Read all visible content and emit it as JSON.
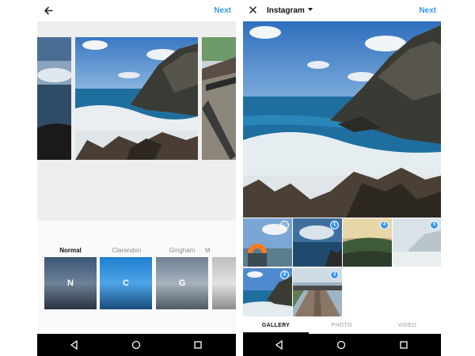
{
  "left_screen": {
    "next_label": "Next",
    "filters": [
      {
        "name": "Normal",
        "letter": "N",
        "selected": true
      },
      {
        "name": "Clarendon",
        "letter": "C",
        "selected": false
      },
      {
        "name": "Gingham",
        "letter": "G",
        "selected": false
      },
      {
        "name": "M",
        "letter": "",
        "selected": false
      }
    ]
  },
  "right_screen": {
    "title": "Instagram",
    "next_label": "Next",
    "gallery": [
      {
        "badge": "",
        "selected": false
      },
      {
        "badge": "1",
        "selected": true
      },
      {
        "badge": "4",
        "selected": true
      },
      {
        "badge": "5",
        "selected": true
      },
      {
        "badge": "2",
        "selected": true
      },
      {
        "badge": "3",
        "selected": true
      }
    ],
    "tabs": [
      "GALLERY",
      "PHOTO",
      "VIDEO"
    ],
    "active_tab": "GALLERY"
  },
  "icons": {
    "back": "arrow-left-icon",
    "close": "close-icon",
    "dropdown": "caret-down-icon",
    "nav_back": "triangle-back-icon",
    "nav_home": "circle-home-icon",
    "nav_recents": "square-recents-icon"
  },
  "colors": {
    "accent": "#3897f0",
    "nav_bar": "#000000"
  }
}
